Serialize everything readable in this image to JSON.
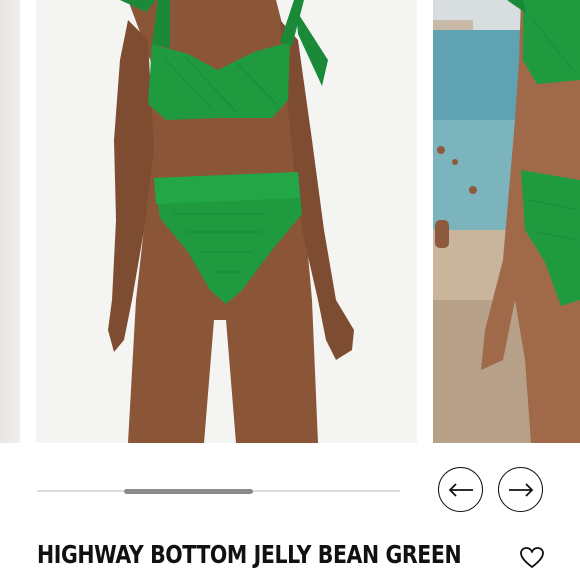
{
  "product": {
    "title": "HIGHWAY BOTTOM JELLY BEAN GREEN"
  },
  "gallery": {
    "previous_icon": "arrow-left-icon",
    "next_icon": "arrow-right-icon",
    "scroll_progress": 0.34
  },
  "actions": {
    "wishlist_icon": "heart-outline-icon"
  },
  "colors": {
    "swimsuit_green": "#1f9a3f",
    "text": "#111111",
    "sea_blue": "#5fa3b3"
  }
}
